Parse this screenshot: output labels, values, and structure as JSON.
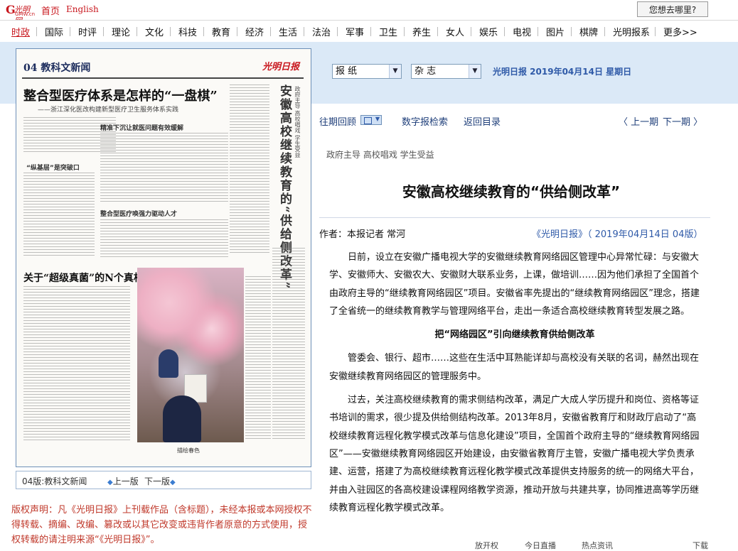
{
  "topbar": {
    "logo_text": "光明网",
    "logo_sub": "GMW.cn",
    "home": "首页",
    "english": "English",
    "where": "您想去哪里?"
  },
  "nav": {
    "items": [
      "时政",
      "国际",
      "时评",
      "理论",
      "文化",
      "科技",
      "教育",
      "经济",
      "生活",
      "法治",
      "军事",
      "卫生",
      "养生",
      "女人",
      "娱乐",
      "电视",
      "图片",
      "棋牌",
      "光明报系",
      "更多>>"
    ]
  },
  "newspaper": {
    "section": "04 教科文新闻",
    "logo": "光明日报",
    "headline": "整合型医疗体系是怎样的“一盘棋”",
    "subheadline": "——浙江深化医改构建新型医疗卫生服务体系实践",
    "vertical_title": "安徽高校继续教育的“供给侧改革”",
    "vertical_small": "政府主导 高校唱戏 学生受益",
    "subhead1": "精准下沉让就医问题有效缓解",
    "subhead2": "“纵基层”是突破口",
    "subhead3": "整合型医疗唤强力驱动人才",
    "headline2": "关于“超级真菌”的N个真相",
    "photo_caption": "描绘春色",
    "footer_label": "04版:教科文新闻",
    "prev": "上一版",
    "next": "下一版"
  },
  "copyright": "版权声明：凡《光明日报》上刊载作品（含标题），未经本报或本网授权不得转载、摘编、改编、篡改或以其它改变或违背作者原意的方式使用，授权转载的请注明来源“《光明日报》”。",
  "toolbar": {
    "select_newspaper": "报 纸",
    "select_magazine": "杂 志",
    "paper_date": "光明日报 2019年04月14日 星期日",
    "archive": "往期回顾",
    "digital_search": "数字报检索",
    "back_catalog": "返回目录",
    "prev_issue": "上一期",
    "next_issue": "下一期"
  },
  "article": {
    "pre_title": "政府主导 高校唱戏 学生受益",
    "title": "安徽高校继续教育的“供给侧改革”",
    "author": "作者：本报记者 常河",
    "source": "《光明日报》（ 2019年04月14日 04版）",
    "p1": "日前，设立在安徽广播电视大学的安徽继续教育网络园区管理中心异常忙碌：与安徽大学、安徽师大、安徽农大、安徽财大联系业务，上课，做培训……因为他们承担了全国首个由政府主导的“继续教育网络园区”项目。安徽省率先提出的“继续教育网络园区”理念，搭建了全省统一的继续教育教学与管理网络平台，走出一条适合高校继续教育转型发展之路。",
    "subhead": "把“网络园区”引向继续教育供给侧改革",
    "p2": "管委会、银行、超市……这些在生活中耳熟能详却与高校没有关联的名词，赫然出现在安徽继续教育网络园区的管理服务中。",
    "p3": "过去，关注高校继续教育的需求侧结构改革，满足广大成人学历提升和岗位、资格等证书培训的需求，很少提及供给侧结构改革。2013年8月，安徽省教育厅和财政厅启动了“高校继续教育远程化教学模式改革与信息化建设”项目，全国首个政府主导的“继续教育网络园区”——安徽继续教育网络园区开始建设，由安徽省教育厅主管，安徽广播电视大学负责承建、运营，搭建了为高校继续教育远程化教学模式改革提供支持服务的统一的网络大平台，并由入驻园区的各高校建设课程网络教学资源，推动开放与共建共享，协同推进高等学历继续教育远程化教学模式改革。"
  },
  "bottom": {
    "items": [
      "放开权",
      "今日直播",
      "热点资讯",
      "下载"
    ]
  },
  "colors": {
    "brand_red": "#c8161d",
    "link_blue": "#2f5aa8",
    "band_blue": "#dbe9f7"
  }
}
